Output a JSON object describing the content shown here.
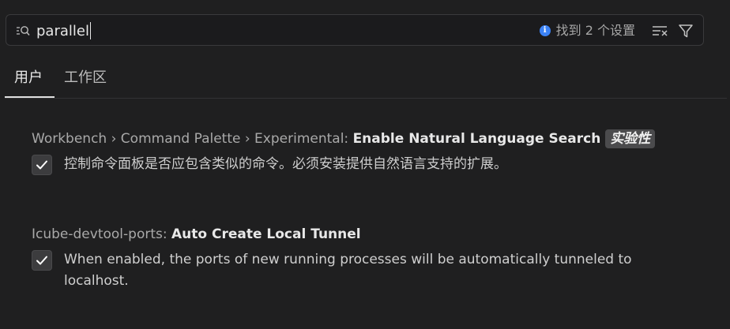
{
  "search": {
    "value": "parallel",
    "results_text": "找到 2 个设置"
  },
  "tabs": [
    {
      "label": "用户",
      "selected": true
    },
    {
      "label": "工作区",
      "selected": false
    }
  ],
  "settings": [
    {
      "category": "Workbench › Command Palette › Experimental: ",
      "key": "Enable Natural Language Search",
      "badge": "实验性",
      "checked": true,
      "description": "控制命令面板是否应包含类似的命令。必须安装提供自然语言支持的扩展。"
    },
    {
      "category": "Icube-devtool-ports: ",
      "key": "Auto Create Local Tunnel",
      "checked": true,
      "description": "When enabled, the ports of new running processes will be automatically tunneled to localhost."
    }
  ],
  "icons": {
    "search": "search-icon",
    "info": "info-icon",
    "clear": "clear-filter-icon",
    "filter": "filter-icon",
    "check": "checkmark-icon"
  },
  "colors": {
    "background": "#1f1f20",
    "info_accent": "#3b82f6",
    "badge_bg": "#4b4b4d"
  }
}
